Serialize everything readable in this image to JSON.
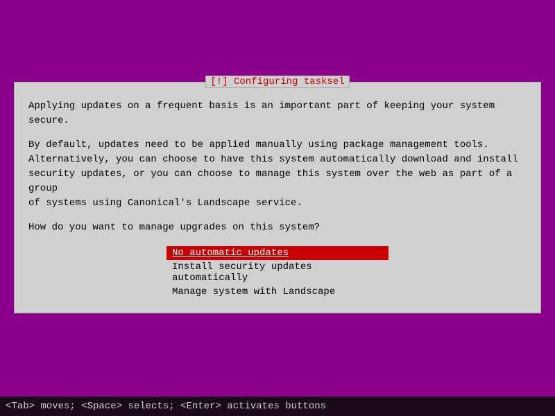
{
  "background_color": "#8b008b",
  "dialog": {
    "title": "[!] Configuring tasksel",
    "body": {
      "paragraph1": "Applying updates on a frequent basis is an important part of keeping your system secure.",
      "paragraph2": "By default, updates need to be applied manually using package management tools.\nAlternatively, you can choose to have this system automatically download and install\nsecurity updates, or you can choose to manage this system over the web as part of a group\nof systems using Canonical's Landscape service.",
      "question": "How do you want to manage upgrades on this system?"
    },
    "options": [
      {
        "label": "No automatic updates",
        "selected": true
      },
      {
        "label": "Install security updates automatically",
        "selected": false
      },
      {
        "label": "Manage system with Landscape",
        "selected": false
      }
    ]
  },
  "status_bar": {
    "text": "<Tab> moves; <Space> selects; <Enter> activates buttons"
  }
}
